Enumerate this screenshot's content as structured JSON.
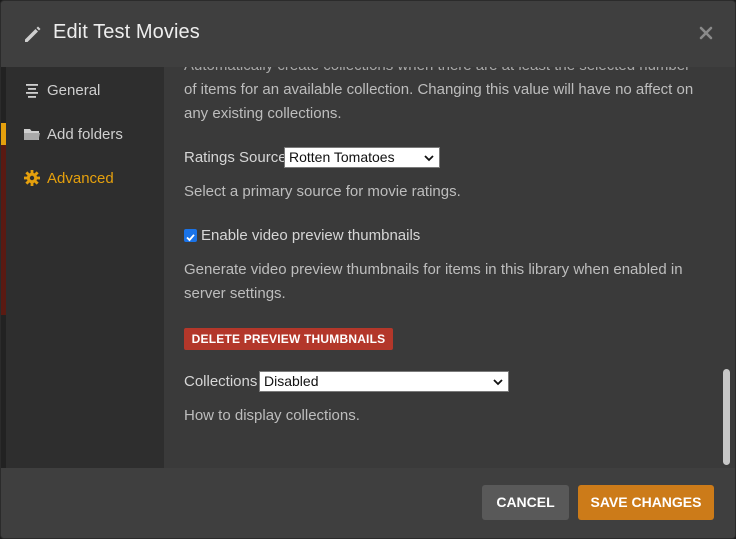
{
  "header": {
    "title": "Edit Test Movies"
  },
  "sidebar": {
    "items": [
      {
        "label": "General",
        "icon": "list-icon"
      },
      {
        "label": "Add folders",
        "icon": "folder-icon"
      },
      {
        "label": "Advanced",
        "icon": "gear-icon",
        "active": true
      }
    ]
  },
  "content": {
    "collections_threshold_desc_top": "Automatically create collections when there are at least the selected number",
    "collections_threshold_desc_rest": "of items for an available collection. Changing this value will have no affect on any existing collections.",
    "ratings_source": {
      "label": "Ratings Source",
      "value": "Rotten Tomatoes",
      "desc": "Select a primary source for movie ratings."
    },
    "video_preview": {
      "label": "Enable video preview thumbnails",
      "checked": true,
      "desc": "Generate video preview thumbnails for items in this library when enabled in server settings."
    },
    "delete_button": "DELETE PREVIEW THUMBNAILS",
    "collections": {
      "label": "Collections",
      "value": "Disabled",
      "desc": "How to display collections."
    }
  },
  "footer": {
    "cancel_label": "CANCEL",
    "save_label": "SAVE CHANGES"
  },
  "colors": {
    "accent": "#e5a00d",
    "danger": "#b3372a",
    "save": "#cc7b19",
    "cancel": "#595959"
  }
}
